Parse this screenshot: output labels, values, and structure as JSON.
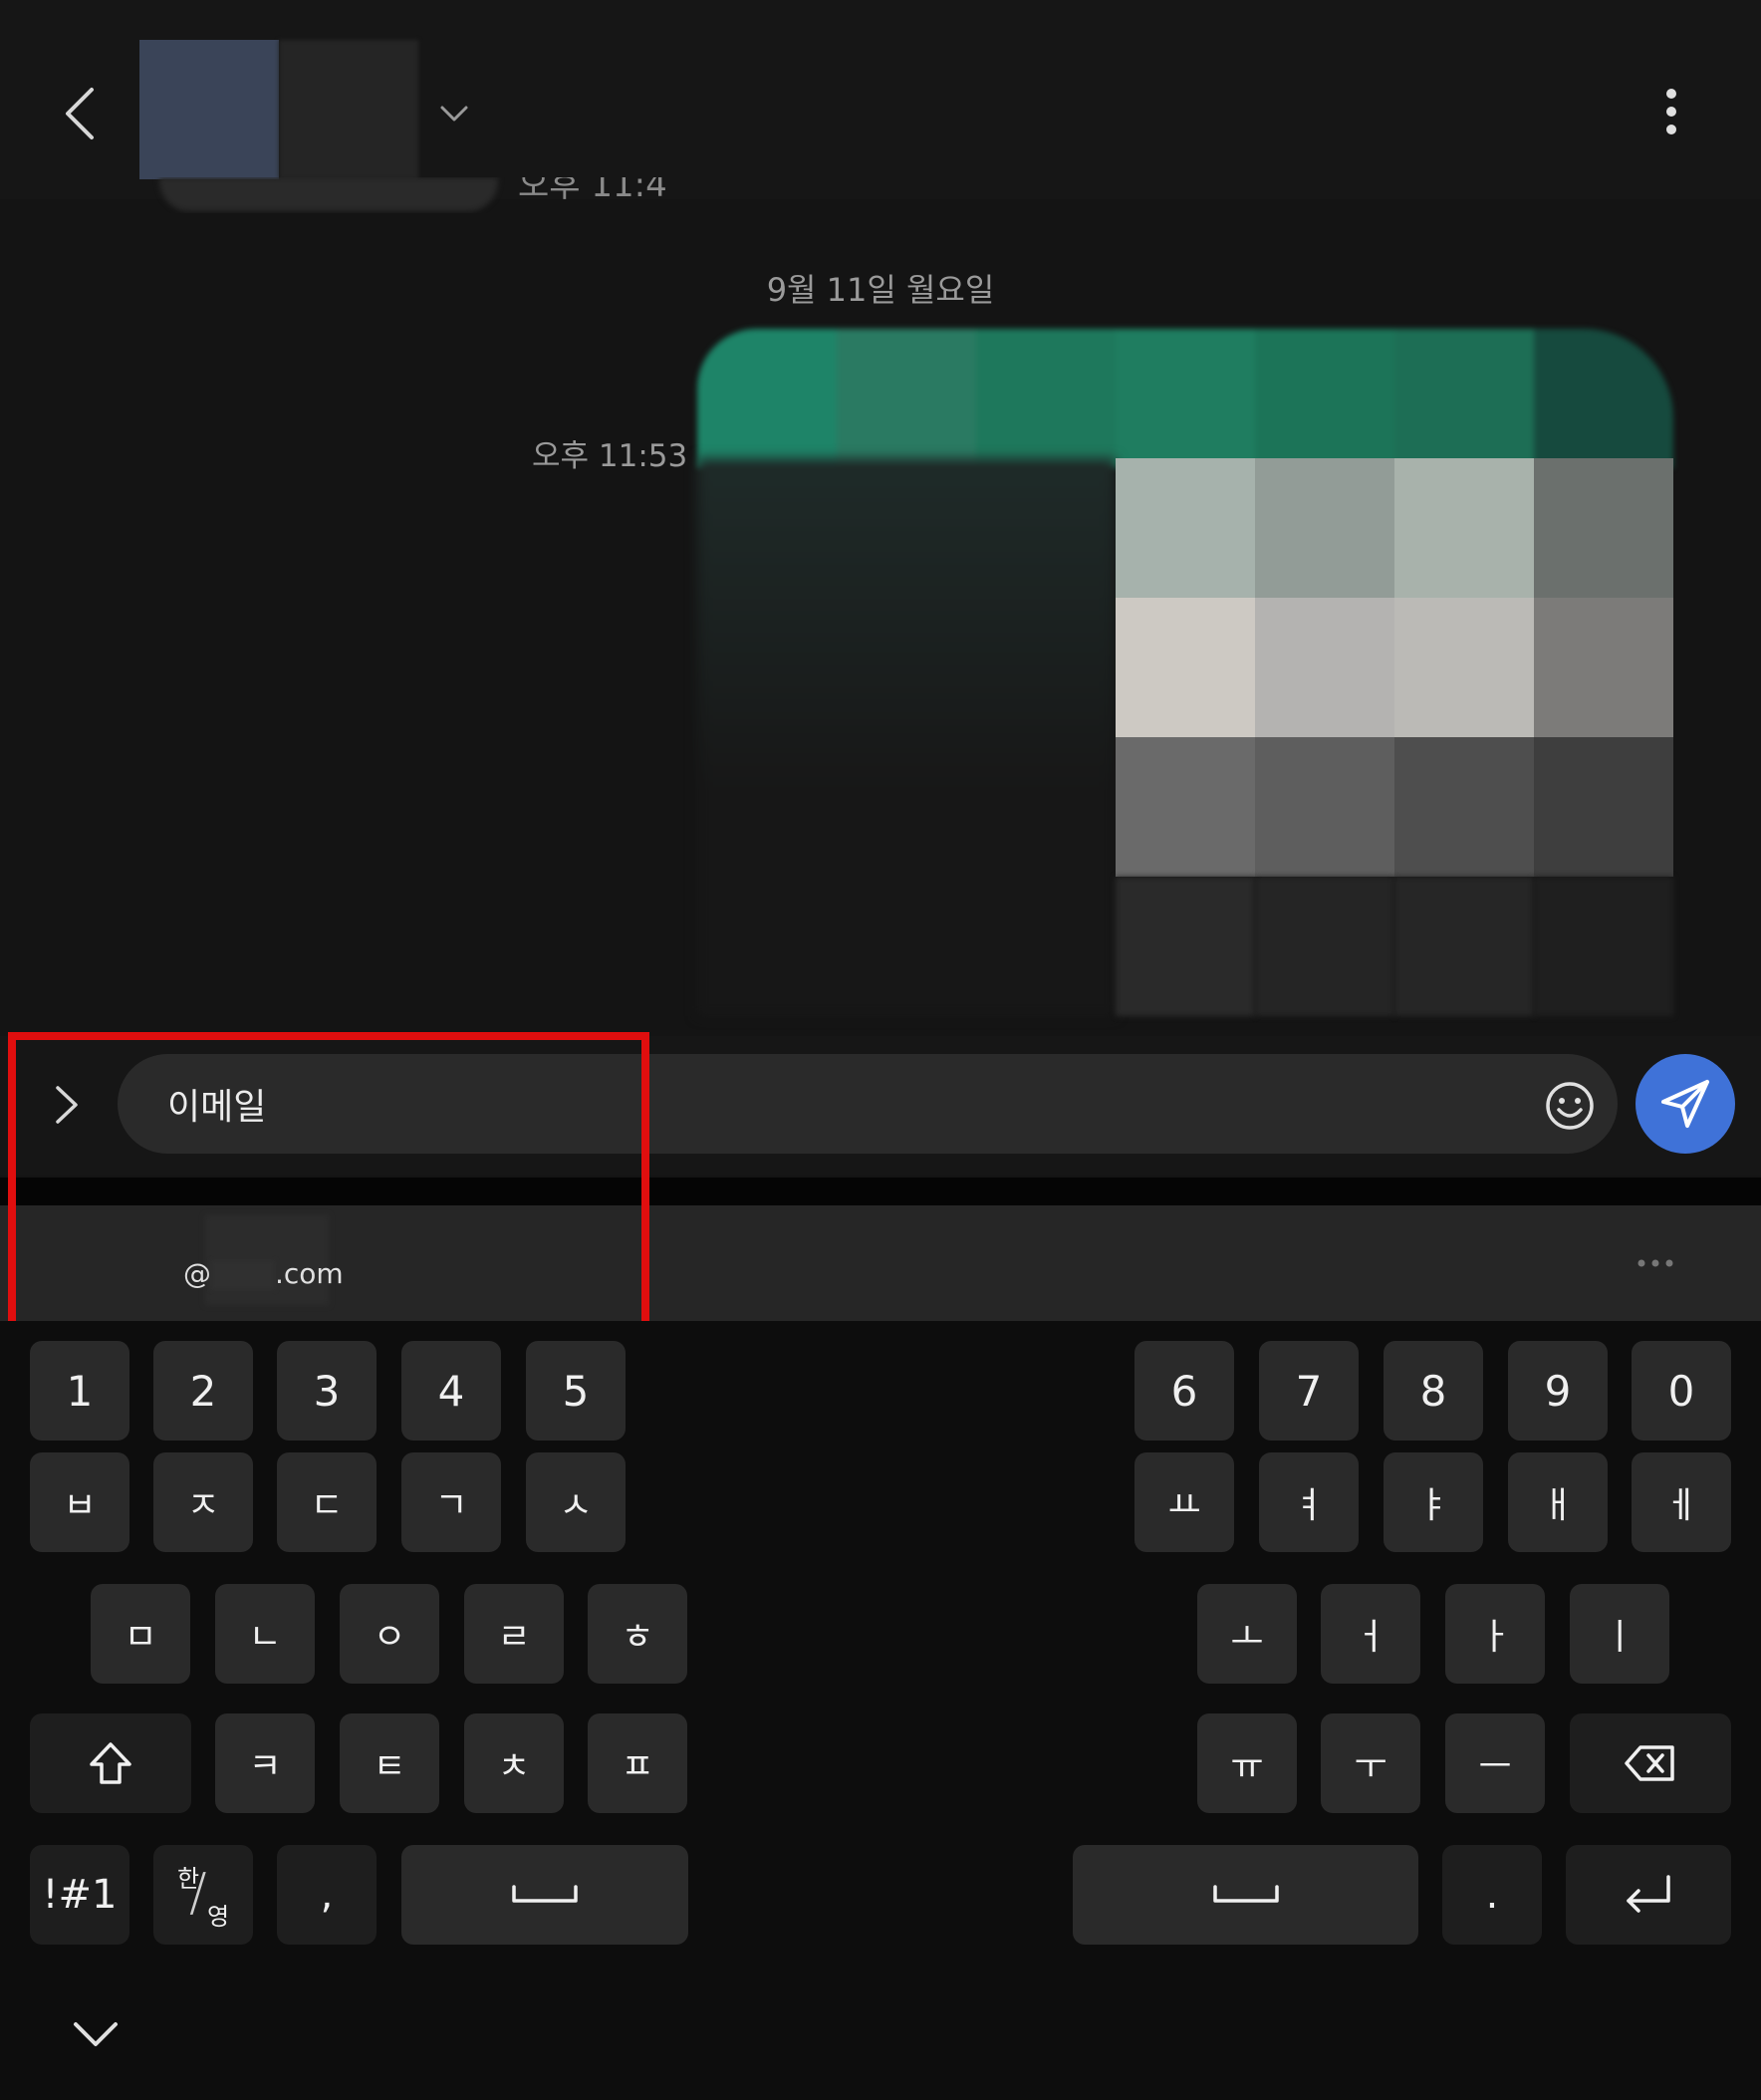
{
  "header": {
    "back_icon": "chevron-left-icon",
    "dropdown_icon": "chevron-down-icon",
    "more_icon": "vertical-ellipsis-icon",
    "partial_time": "오후 11:4"
  },
  "conversation": {
    "date_separator": "9월 11일 월요일",
    "message_time": "오후 11:53"
  },
  "composer": {
    "input_value": "이메일",
    "expand_icon": "chevron-right-icon",
    "emoji_icon": "smiley-icon",
    "send_icon": "paper-plane-icon",
    "send_color": "#3f72d8"
  },
  "suggestion": {
    "prefix": "@",
    "suffix": ".com",
    "more_icon": "horizontal-ellipsis-icon"
  },
  "keyboard": {
    "left_numbers": [
      "1",
      "2",
      "3",
      "4",
      "5"
    ],
    "right_numbers": [
      "6",
      "7",
      "8",
      "9",
      "0"
    ],
    "left_row1": [
      "ㅂ",
      "ㅈ",
      "ㄷ",
      "ㄱ",
      "ㅅ"
    ],
    "right_row1": [
      "ㅛ",
      "ㅕ",
      "ㅑ",
      "ㅐ",
      "ㅔ"
    ],
    "left_row2": [
      "ㅁ",
      "ㄴ",
      "ㅇ",
      "ㄹ",
      "ㅎ"
    ],
    "right_row2": [
      "ㅗ",
      "ㅓ",
      "ㅏ",
      "ㅣ"
    ],
    "left_row3": [
      "ㅋ",
      "ㅌ",
      "ㅊ",
      "ㅍ"
    ],
    "right_row3": [
      "ㅠ",
      "ㅜ",
      "ㅡ"
    ],
    "symbols_key": "!#1",
    "lang_key_top": "한",
    "lang_key_bottom": "영",
    "comma_key": ",",
    "period_key": ".",
    "shift_icon": "shift-icon",
    "backspace_icon": "backspace-icon",
    "space_icon": "space-icon",
    "enter_icon": "enter-icon",
    "hide_icon": "chevron-down-icon"
  },
  "highlight_color": "#e00e0e"
}
